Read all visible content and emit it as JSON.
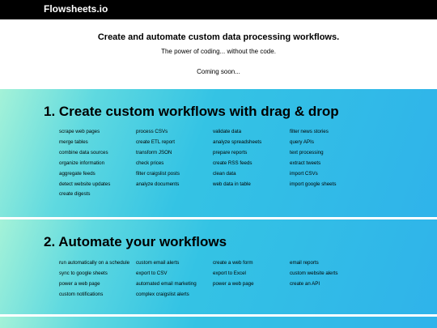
{
  "header": {
    "brand": "Flowsheets.io"
  },
  "hero": {
    "title": "Create and automate custom data processing workflows.",
    "subtitle": "The power of coding... without the code.",
    "coming_soon": "Coming soon..."
  },
  "section1": {
    "title": "1. Create custom workflows with drag & drop",
    "columns": [
      [
        "scrape web pages",
        "merge tables",
        "combine data sources",
        "organize information",
        "aggregate feeds",
        "detect website updates",
        "create digests"
      ],
      [
        "process CSVs",
        "create ETL report",
        "transform JSON",
        "check prices",
        "filter craigslist posts",
        "analyze documents"
      ],
      [
        "validate data",
        "analyze spreadsheets",
        "prepare reports",
        "create RSS feeds",
        "clean data",
        "web data in table"
      ],
      [
        "filter news stories",
        "query APIs",
        "text processing",
        "extract tweets",
        "import CSVs",
        "import google sheets"
      ]
    ]
  },
  "section2": {
    "title": "2. Automate your workflows",
    "columns": [
      [
        "run automatically on a schedule",
        "sync to google sheets",
        "power a web page",
        "custom notifications"
      ],
      [
        "custom email alerts",
        "export to CSV",
        "automated email marketing",
        "complex craigslist alerts"
      ],
      [
        "create a web form",
        "export to Excel",
        "power a web page"
      ],
      [
        "email reports",
        "custom website alerts",
        "create an API"
      ]
    ]
  },
  "colors": {
    "topbar": "#000000",
    "gradient_start": "#a4f2d8",
    "gradient_end": "#2fb3ea"
  }
}
